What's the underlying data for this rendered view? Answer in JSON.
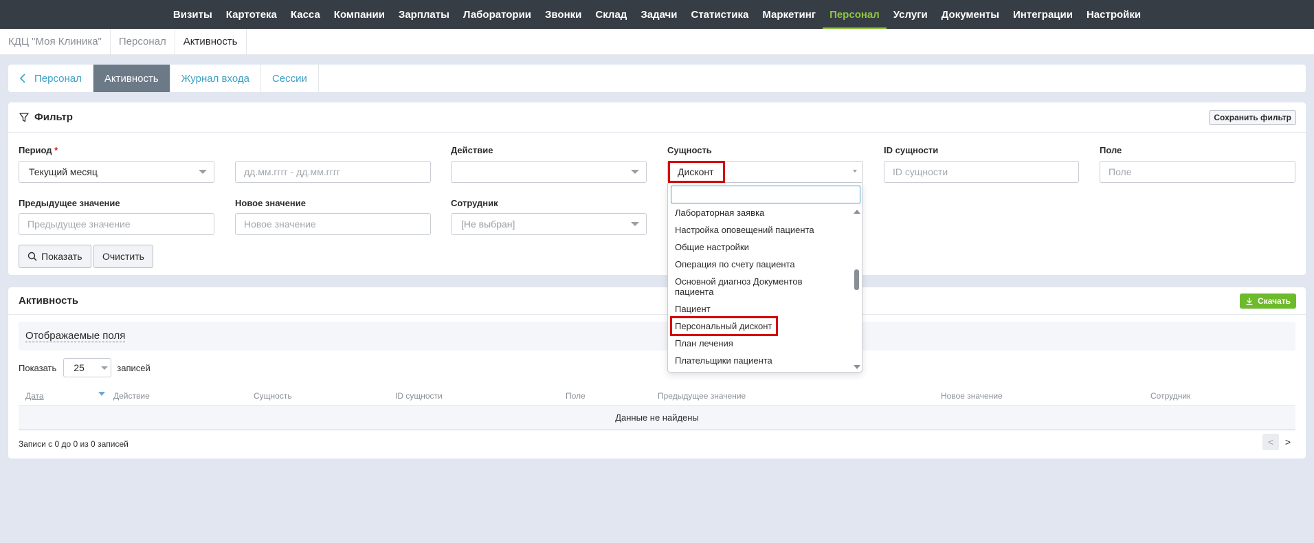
{
  "top_nav": {
    "items": [
      {
        "label": "Визиты"
      },
      {
        "label": "Картотека"
      },
      {
        "label": "Касса"
      },
      {
        "label": "Компании"
      },
      {
        "label": "Зарплаты"
      },
      {
        "label": "Лаборатории"
      },
      {
        "label": "Звонки"
      },
      {
        "label": "Склад"
      },
      {
        "label": "Задачи"
      },
      {
        "label": "Статистика"
      },
      {
        "label": "Маркетинг"
      },
      {
        "label": "Персонал",
        "active": true
      },
      {
        "label": "Услуги"
      },
      {
        "label": "Документы"
      },
      {
        "label": "Интеграции"
      },
      {
        "label": "Настройки"
      }
    ],
    "accent_color": "#8dc63f",
    "background": "#373d45"
  },
  "breadcrumb": {
    "items": [
      "КДЦ \"Моя Клиника\"",
      "Персонал",
      "Активность"
    ]
  },
  "tabs": {
    "back_label": "Персонал",
    "items": [
      "Активность",
      "Журнал входа",
      "Сессии"
    ],
    "active": "Активность"
  },
  "filter": {
    "title": "Фильтр",
    "save_button": "Сохранить фильтр",
    "period": {
      "label": "Период",
      "required_mark": "*",
      "value": "Текущий месяц"
    },
    "date_range": {
      "placeholder": "дд.мм.гггг - дд.мм.гггг"
    },
    "action": {
      "label": "Действие",
      "value": ""
    },
    "entity": {
      "label": "Сущность",
      "value": "Дисконт"
    },
    "entity_id": {
      "label": "ID сущности",
      "placeholder": "ID сущности"
    },
    "field": {
      "label": "Поле",
      "placeholder": "Поле"
    },
    "previous_value": {
      "label": "Предыдущее значение",
      "placeholder": "Предыдущее значение"
    },
    "new_value": {
      "label": "Новое значение",
      "placeholder": "Новое значение"
    },
    "employee": {
      "label": "Сотрудник",
      "value": "[Не выбран]"
    },
    "show_button": "Показать",
    "clear_button": "Очистить"
  },
  "entity_dropdown": {
    "options": [
      "Лабораторная заявка",
      "Настройка оповещений пациента",
      "Общие настройки",
      "Операция по счету пациента",
      "Основной диагноз Документов пациента",
      "Пациент",
      "Персональный дисконт",
      "План лечения",
      "Плательщики пациента"
    ],
    "highlighted": "Персональный дисконт",
    "scroll_position": 0.45
  },
  "activity": {
    "title": "Активность",
    "download_button": "Скачать",
    "shown_fields_label": "Отображаемые поля",
    "show_label": "Показать",
    "per_page": "25",
    "records_label": "записей",
    "columns": [
      "Дата",
      "Действие",
      "Сущность",
      "ID сущности",
      "Поле",
      "Предыдущее значение",
      "Новое значение",
      "Сотрудник"
    ],
    "empty_text": "Данные не найдены",
    "records_info": "Записи с 0 до 0 из 0 записей",
    "prev_glyph": "<",
    "next_glyph": ">"
  },
  "colors": {
    "link": "#3aa0c6",
    "active_tab": "#6c7987",
    "download": "#6dbb2c",
    "highlight": "#d40000",
    "required": "#e02020"
  }
}
